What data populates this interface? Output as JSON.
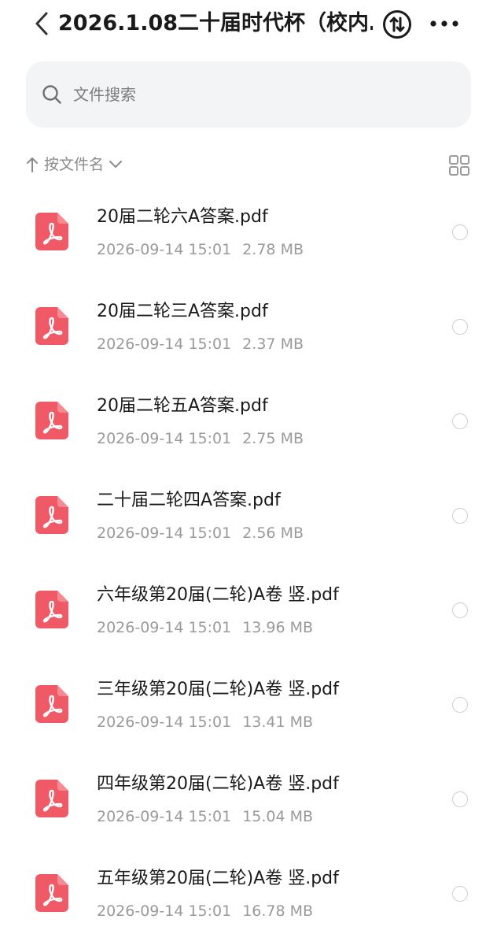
{
  "header": {
    "title": "2026.1.08二十届时代杯（校内…",
    "back_icon": "chevron-left-icon",
    "sort_toggle_icon": "sort-updown-circle-icon",
    "more_icon": "more-dots-icon"
  },
  "search": {
    "placeholder": "文件搜索",
    "icon": "search-icon"
  },
  "sort": {
    "label": "按文件名",
    "arrow_icon": "arrow-up-icon",
    "chevron_icon": "chevron-down-icon",
    "view_toggle_icon": "grid-view-icon"
  },
  "colors": {
    "pdf_icon": "#ef5a66",
    "text_primary": "#1a1a1a",
    "text_secondary": "#9a9a9a",
    "search_bg": "#f3f4f6"
  },
  "files": [
    {
      "name": "20届二轮六A答案.pdf",
      "date": "2026-09-14 15:01",
      "size": "2.78 MB"
    },
    {
      "name": "20届二轮三A答案.pdf",
      "date": "2026-09-14 15:01",
      "size": "2.37 MB"
    },
    {
      "name": "20届二轮五A答案.pdf",
      "date": "2026-09-14 15:01",
      "size": "2.75 MB"
    },
    {
      "name": "二十届二轮四A答案.pdf",
      "date": "2026-09-14 15:01",
      "size": "2.56 MB"
    },
    {
      "name": "六年级第20届(二轮)A卷 竖.pdf",
      "date": "2026-09-14 15:01",
      "size": "13.96 MB"
    },
    {
      "name": "三年级第20届(二轮)A卷 竖.pdf",
      "date": "2026-09-14 15:01",
      "size": "13.41 MB"
    },
    {
      "name": "四年级第20届(二轮)A卷 竖.pdf",
      "date": "2026-09-14 15:01",
      "size": "15.04 MB"
    },
    {
      "name": "五年级第20届(二轮)A卷 竖.pdf",
      "date": "2026-09-14 15:01",
      "size": "16.78 MB"
    }
  ]
}
